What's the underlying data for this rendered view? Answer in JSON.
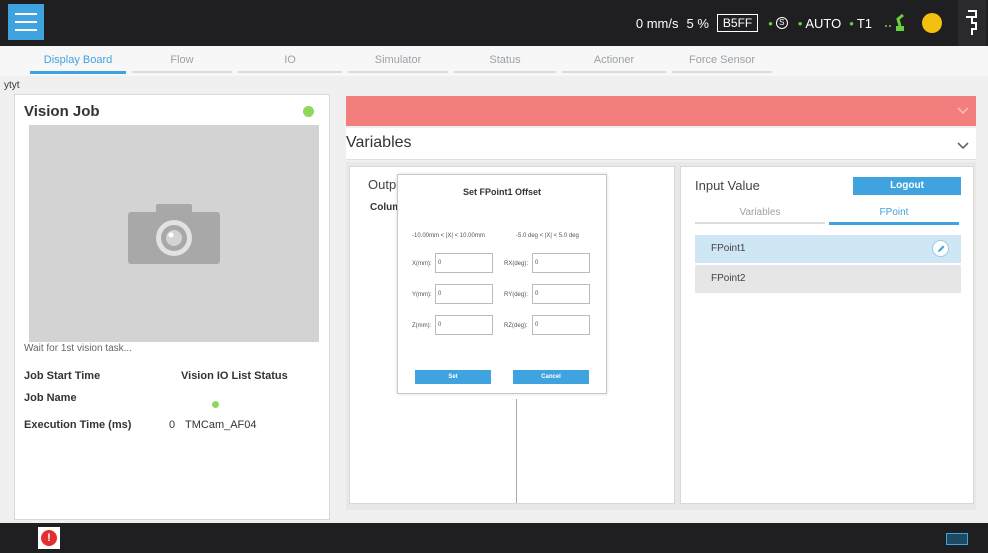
{
  "status": {
    "speed": "0 mm/s",
    "percent": "5 %",
    "project_code": "B5FF",
    "safety_symbol": "S",
    "mode": "AUTO",
    "mode_dot": "•",
    "t1": "T1",
    "t1_dot": "•"
  },
  "tabs": [
    "Display Board",
    "Flow",
    "IO",
    "Simulator",
    "Status",
    "Actioner",
    "Force Sensor"
  ],
  "project_name": "ytyt",
  "vision": {
    "title": "Vision Job",
    "wait_text": "Wait for 1st vision task...",
    "job_start_time_label": "Job Start Time",
    "io_list_status_label": "Vision IO List Status",
    "job_name_label": "Job Name",
    "execution_time_label": "Execution Time (ms)",
    "execution_time_value": "0",
    "camera_name": "TMCam_AF04"
  },
  "variables_header": "Variables",
  "output": {
    "title": "Outpu",
    "column_label": "Colum"
  },
  "input": {
    "title": "Input Value",
    "logout_label": "Logout",
    "subtabs": [
      "Variables",
      "FPoint"
    ],
    "points": [
      "FPoint1",
      "FPoint2"
    ]
  },
  "dialog": {
    "title": "Set FPoint1 Offset",
    "range_mm": "-10.00mm < |X| < 10.00mm",
    "range_deg": "-5.0 deg < |X| < 5.0 deg",
    "x_label": "X(mm):",
    "x_value": "0",
    "y_label": "Y(mm):",
    "y_value": "0",
    "z_label": "Z(mm):",
    "z_value": "0",
    "rx_label": "RX(deg):",
    "rx_value": "0",
    "ry_label": "RY(deg):",
    "ry_value": "0",
    "rz_label": "RZ(deg):",
    "rz_value": "0",
    "set_label": "Set",
    "cancel_label": "Cancel"
  },
  "error_symbol": "!",
  "colors": {
    "accent": "#3fa3e0",
    "alarm_bar": "#f27e7e",
    "status_green": "#8fd85c",
    "indicator_yellow": "#f3c00f",
    "error_red": "#e23030"
  }
}
